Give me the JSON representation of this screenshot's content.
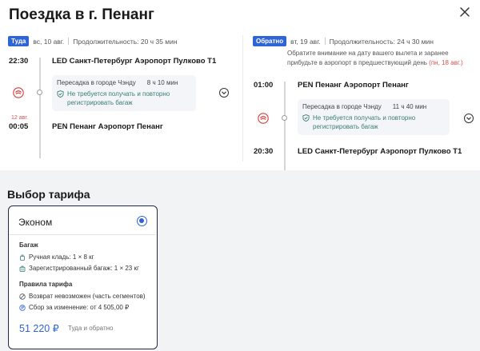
{
  "title": "Поездка в г. Пенанг",
  "outbound": {
    "badge": "Туда",
    "date": "вс, 10 авг.",
    "duration": "Продолжительность: 20 ч 35 мин",
    "depart_time": "22:30",
    "depart_airport": "LED Санкт-Петербург Аэропорт Пулково Т1",
    "transfer_city": "Пересадка в городе Чэнду",
    "transfer_time": "8 ч 10 мин",
    "baggage_note": "Не требуется получать и повторно регистрировать багаж",
    "arrival_nextday": "12 авг.",
    "arrive_time": "00:05",
    "arrive_airport": "PEN Пенанг Аэропорт Пенанг"
  },
  "return": {
    "badge": "Обратно",
    "date": "вт, 19 авг.",
    "duration": "Продолжительность: 24 ч 30 мин",
    "note_text": "Обратите внимание на дату вашего вылета и заранее прибудьте в аэропорт в предшествующий день",
    "note_date": "(пн, 18 авг.)",
    "depart_time": "01:00",
    "depart_airport": "PEN Пенанг Аэропорт Пенанг",
    "transfer_city": "Пересадка в городе Чэнду",
    "transfer_time": "11 ч 40 мин",
    "baggage_note": "Не требуется получать и повторно регистрировать багаж",
    "arrive_time": "20:30",
    "arrive_airport": "LED Санкт-Петербург Аэропорт Пулково Т1"
  },
  "tariff": {
    "section_title": "Выбор тарифа",
    "name": "Эконом",
    "baggage_header": "Багаж",
    "hand_luggage": "Ручная кладь: 1 × 8 кг",
    "checked_baggage": "Зарегистрированный багаж: 1 × 23 кг",
    "rules_header": "Правила тарифа",
    "refund": "Возврат невозможен (часть сегментов)",
    "change_fee": "Сбор за изменение: от 4 505,00 ₽",
    "price": "51 220 ₽",
    "price_note": "Туда и обратно"
  },
  "icons": {
    "close": "close-icon",
    "airline_logo": "sichuan-airlines-logo-icon",
    "shield": "shield-check-icon",
    "expand": "chevron-down-icon",
    "hand_luggage": "hand-luggage-icon",
    "checked_baggage": "suitcase-icon",
    "refund": "no-refund-icon",
    "change_fee": "currency-icon"
  },
  "colors": {
    "accent": "#2f64d6",
    "warning": "#d9534f",
    "baggage_note": "#3a7d76"
  }
}
